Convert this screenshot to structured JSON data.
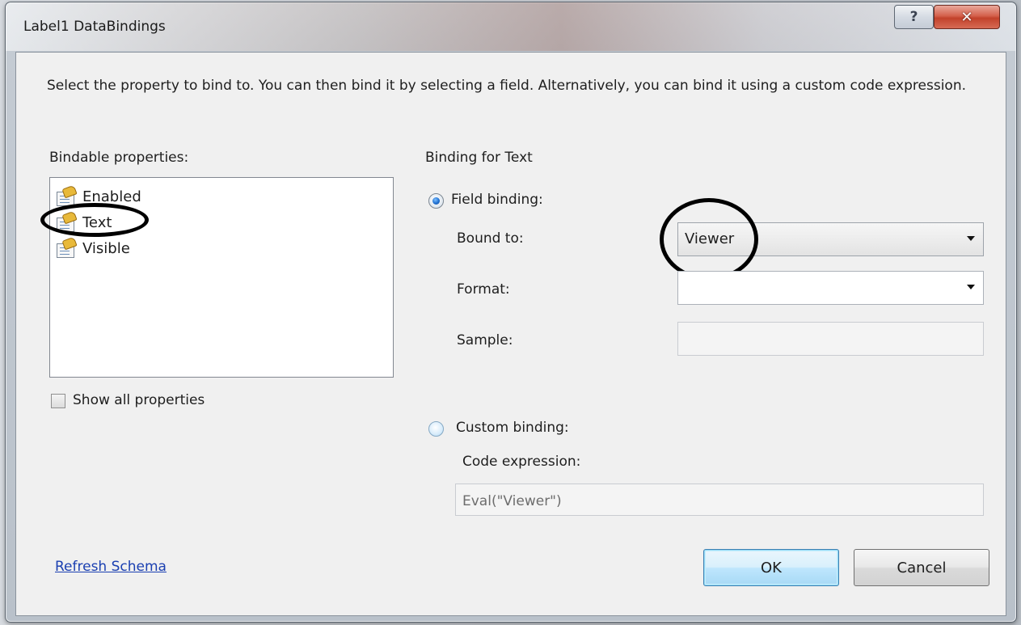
{
  "window": {
    "title": "Label1 DataBindings",
    "help_glyph": "?",
    "close_glyph": "✕"
  },
  "description": "Select the property to bind to. You can then bind it by selecting a field. Alternatively, you can bind it using a custom code expression.",
  "left_panel": {
    "heading": "Bindable properties:",
    "properties": [
      {
        "label": "Enabled",
        "icon": "property-icon"
      },
      {
        "label": "Text",
        "icon": "property-icon"
      },
      {
        "label": "Visible",
        "icon": "property-icon"
      }
    ],
    "show_all_label": "Show all properties",
    "show_all_checked": false
  },
  "right_panel": {
    "heading": "Binding for Text",
    "field_binding": {
      "label": "Field binding:",
      "selected": true,
      "bound_to_label": "Bound to:",
      "bound_to_value": "Viewer",
      "format_label": "Format:",
      "format_value": "",
      "sample_label": "Sample:",
      "sample_value": ""
    },
    "custom_binding": {
      "label": "Custom binding:",
      "selected": false,
      "code_expression_label": "Code expression:",
      "code_expression_value": "Eval(\"Viewer\")"
    }
  },
  "footer": {
    "refresh_link": "Refresh Schema",
    "ok_label": "OK",
    "cancel_label": "Cancel"
  },
  "colors": {
    "link": "#1a3fb1",
    "annotation": "#000000",
    "close_button": "#c2422b"
  }
}
